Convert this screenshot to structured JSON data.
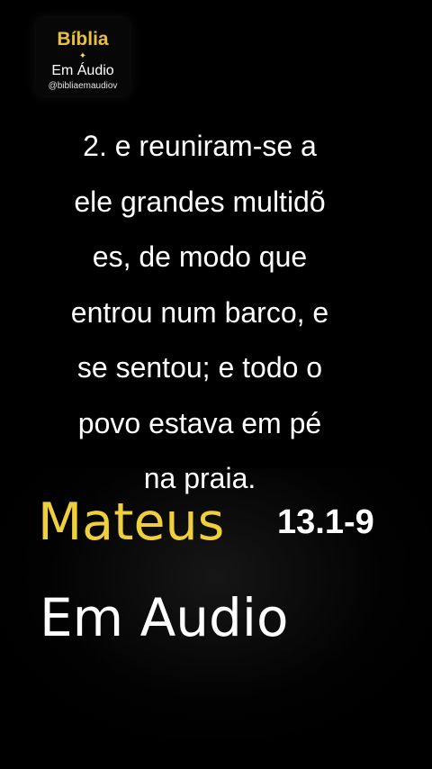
{
  "logo": {
    "title": "Bíblia",
    "star": "✦",
    "subtitle": "Em Áudio",
    "handle": "@bibliaemaudiov"
  },
  "verse": {
    "lines": [
      "2. e reuniram-se a",
      "ele grandes multidõ",
      "es, de modo que",
      "entrou num barco, e",
      "se sentou; e todo o",
      "povo estava em pé",
      "na praia."
    ]
  },
  "reference": {
    "book": "Mateus",
    "chapter_verses": "13.1-9"
  },
  "caption": "Em Audio",
  "colors": {
    "background": "#000000",
    "gold": "#f0cf3c",
    "text": "#ffffff"
  }
}
